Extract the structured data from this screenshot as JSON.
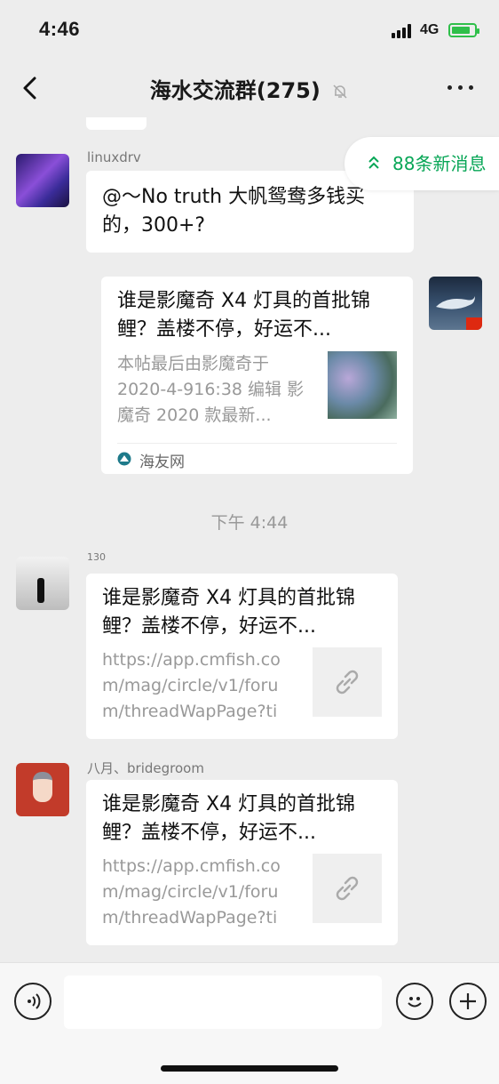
{
  "status": {
    "time": "4:46",
    "network": "4G",
    "signal_icon": "signal-bars-icon",
    "battery_icon": "battery-charging-icon"
  },
  "nav": {
    "title": "海水交流群(275)",
    "back_icon": "chevron-left-icon",
    "mute_icon": "bell-muted-icon",
    "more_icon": "ellipsis-icon"
  },
  "new_messages": {
    "label": "88条新消息",
    "icon": "double-chevron-up-icon",
    "color": "#07A656"
  },
  "messages": [
    {
      "sender": "linuxdrv",
      "text": "@～No truth 大帆鸳鸯多钱买的，300+?"
    },
    {
      "title": "谁是影魔奇 X4 灯具的首批锦鲤？盖楼不停，好运不...",
      "desc": "本帖最后由影魔奇于 2020-4-916:38 编辑 影魔奇 2020 款最新...",
      "source": "海友网"
    },
    {
      "time": "下午 4:44"
    },
    {
      "sender": "130",
      "title": "谁是影魔奇 X4 灯具的首批锦鲤？盖楼不停，好运不...",
      "desc": "https://app.cmfish.com/mag/circle/v1/forum/threadWapPage?tid..."
    },
    {
      "sender": "八月、bridegroom",
      "title": "谁是影魔奇 X4 灯具的首批锦鲤？盖楼不停，好运不...",
      "desc": "https://app.cmfish.com/mag/circle/v1/forum/threadWapPage?tid..."
    }
  ],
  "input": {
    "value": "",
    "voice_icon": "voice-icon",
    "emoji_icon": "emoji-icon",
    "plus_icon": "plus-icon"
  }
}
